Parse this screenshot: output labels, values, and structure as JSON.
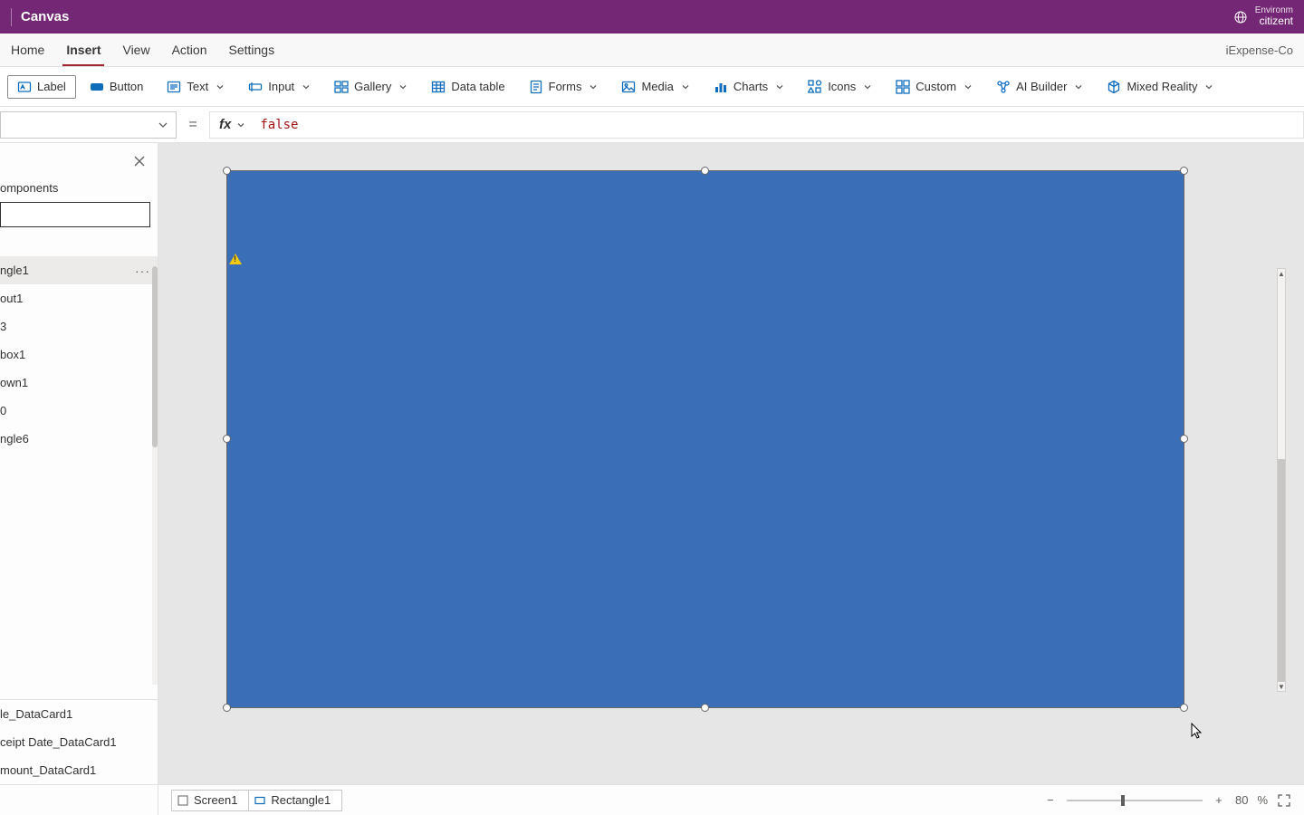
{
  "titlebar": {
    "title": "Canvas",
    "env_label": "Environm",
    "env_value": "citizent"
  },
  "menu": {
    "tabs": [
      "Home",
      "Insert",
      "View",
      "Action",
      "Settings"
    ],
    "active": "Insert",
    "right": "iExpense-Co"
  },
  "ribbon": {
    "label_btn": "Label",
    "button_btn": "Button",
    "text_btn": "Text",
    "input_btn": "Input",
    "gallery_btn": "Gallery",
    "datatable_btn": "Data table",
    "forms_btn": "Forms",
    "media_btn": "Media",
    "charts_btn": "Charts",
    "icons_btn": "Icons",
    "custom_btn": "Custom",
    "ai_btn": "AI Builder",
    "mr_btn": "Mixed Reality"
  },
  "formula": {
    "fx": "fx",
    "value": "false"
  },
  "tree": {
    "tab_label": "omponents",
    "items": [
      "ngle1",
      "out1",
      "3",
      "box1",
      "own1",
      "0",
      "ngle6"
    ],
    "bottom": [
      "le_DataCard1",
      "ceipt Date_DataCard1",
      "mount_DataCard1"
    ]
  },
  "status": {
    "crumb1": "Screen1",
    "crumb2": "Rectangle1",
    "zoom": "80",
    "pct": "%"
  }
}
